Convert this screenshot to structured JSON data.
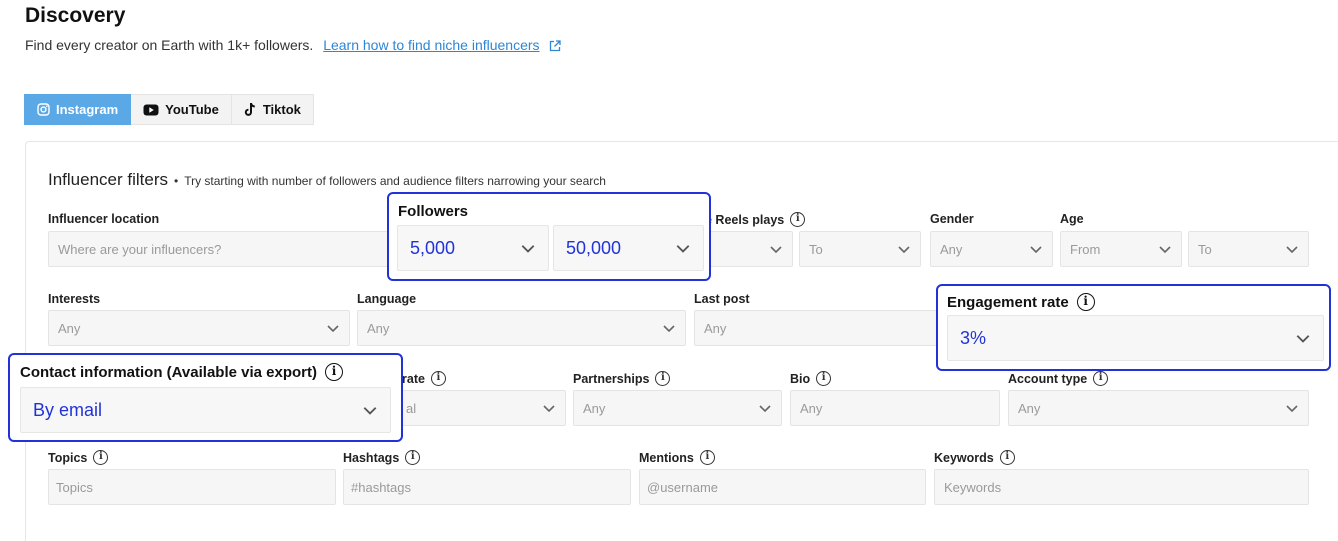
{
  "header": {
    "title": "Discovery",
    "subtitle": "Find every creator on Earth with 1k+ followers.",
    "learn_link": "Learn how to find niche influencers"
  },
  "tabs": [
    {
      "label": "Instagram",
      "icon": "instagram-icon",
      "active": true
    },
    {
      "label": "YouTube",
      "icon": "youtube-icon",
      "active": false
    },
    {
      "label": "Tiktok",
      "icon": "tiktok-icon",
      "active": false
    }
  ],
  "filters": {
    "title": "Influencer filters",
    "hint": "Try starting with number of followers and audience filters narrowing your search",
    "location": {
      "label": "Influencer location",
      "placeholder": "Where are your influencers?"
    },
    "followers": {
      "label": "Followers",
      "min": "5,000",
      "max": "50,000"
    },
    "reels_plays": {
      "label": "e Reels plays",
      "max_placeholder": "To"
    },
    "gender": {
      "label": "Gender",
      "value": "Any"
    },
    "age": {
      "label": "Age",
      "from": "From",
      "to": "To"
    },
    "interests": {
      "label": "Interests",
      "value": "Any"
    },
    "language": {
      "label": "Language",
      "value": "Any"
    },
    "last_post": {
      "label": "Last post",
      "value": "Any"
    },
    "engagement": {
      "label": "Engagement rate",
      "value": "3%"
    },
    "contact": {
      "label": "Contact information (Available via export)",
      "value": "By email"
    },
    "growth": {
      "label": "rate",
      "value": "al"
    },
    "partnerships": {
      "label": "Partnerships",
      "value": "Any"
    },
    "bio": {
      "label": "Bio",
      "placeholder": "Any"
    },
    "account_type": {
      "label": "Account type",
      "value": "Any"
    },
    "topics": {
      "label": "Topics",
      "placeholder": "Topics"
    },
    "hashtags": {
      "label": "Hashtags",
      "placeholder": "#hashtags"
    },
    "mentions": {
      "label": "Mentions",
      "placeholder": "@username"
    },
    "keywords": {
      "label": "Keywords",
      "placeholder": "Keywords"
    }
  },
  "colors": {
    "accent": "#5aa8e6",
    "highlight": "#2133d8",
    "link": "#2e86d4"
  }
}
